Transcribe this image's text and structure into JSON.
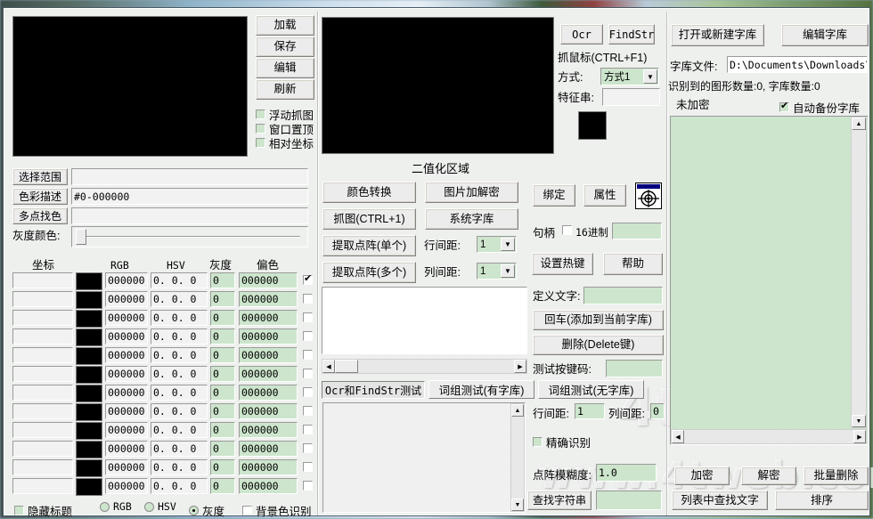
{
  "window": {
    "title": ""
  },
  "capture": {
    "buttons": [
      {
        "name": "load",
        "label": "加载"
      },
      {
        "name": "save",
        "label": "保存"
      },
      {
        "name": "edit",
        "label": "编辑"
      },
      {
        "name": "refresh",
        "label": "刷新"
      }
    ],
    "checkboxes": [
      {
        "name": "float-capture",
        "label": "浮动抓图",
        "checked": false
      },
      {
        "name": "window-topmost",
        "label": "窗口置顶",
        "checked": false
      },
      {
        "name": "relative-coords",
        "label": "相对坐标",
        "checked": false
      }
    ]
  },
  "color_tools": {
    "select_range_label": "选择范围",
    "select_range_value": "",
    "color_desc_label": "色彩描述",
    "color_desc_value": "#0-000000",
    "multipoint_label": "多点找色",
    "multipoint_value": "",
    "gray_color_label": "灰度颜色:",
    "gray_slider_value": 0
  },
  "color_table": {
    "headers": [
      "坐标",
      "RGB",
      "HSV",
      "灰度",
      "偏色"
    ],
    "rows": [
      {
        "coord": "",
        "swatch": "#000000",
        "rgb": "000000",
        "hsv": "0. 0. 0",
        "gray": "0",
        "offset": "000000",
        "checked": true
      },
      {
        "coord": "",
        "swatch": "#000000",
        "rgb": "000000",
        "hsv": "0. 0. 0",
        "gray": "0",
        "offset": "000000",
        "checked": false
      },
      {
        "coord": "",
        "swatch": "#000000",
        "rgb": "000000",
        "hsv": "0. 0. 0",
        "gray": "0",
        "offset": "000000",
        "checked": false
      },
      {
        "coord": "",
        "swatch": "#000000",
        "rgb": "000000",
        "hsv": "0. 0. 0",
        "gray": "0",
        "offset": "000000",
        "checked": false
      },
      {
        "coord": "",
        "swatch": "#000000",
        "rgb": "000000",
        "hsv": "0. 0. 0",
        "gray": "0",
        "offset": "000000",
        "checked": false
      },
      {
        "coord": "",
        "swatch": "#000000",
        "rgb": "000000",
        "hsv": "0. 0. 0",
        "gray": "0",
        "offset": "000000",
        "checked": false
      },
      {
        "coord": "",
        "swatch": "#000000",
        "rgb": "000000",
        "hsv": "0. 0. 0",
        "gray": "0",
        "offset": "000000",
        "checked": false
      },
      {
        "coord": "",
        "swatch": "#000000",
        "rgb": "000000",
        "hsv": "0. 0. 0",
        "gray": "0",
        "offset": "000000",
        "checked": false
      },
      {
        "coord": "",
        "swatch": "#000000",
        "rgb": "000000",
        "hsv": "0. 0. 0",
        "gray": "0",
        "offset": "000000",
        "checked": false
      },
      {
        "coord": "",
        "swatch": "#000000",
        "rgb": "000000",
        "hsv": "0. 0. 0",
        "gray": "0",
        "offset": "000000",
        "checked": false
      },
      {
        "coord": "",
        "swatch": "#000000",
        "rgb": "000000",
        "hsv": "0. 0. 0",
        "gray": "0",
        "offset": "000000",
        "checked": false
      },
      {
        "coord": "",
        "swatch": "#000000",
        "rgb": "000000",
        "hsv": "0. 0. 0",
        "gray": "0",
        "offset": "000000",
        "checked": false
      }
    ]
  },
  "footer_left": {
    "hide_title": {
      "label": "隐藏标题",
      "checked": false
    },
    "modes": [
      {
        "name": "rgb",
        "label": "RGB",
        "selected": false
      },
      {
        "name": "hsv",
        "label": "HSV",
        "selected": false
      },
      {
        "name": "gray",
        "label": "灰度",
        "selected": true
      }
    ],
    "bg_recognize": {
      "label": "背景色识别",
      "checked": false
    }
  },
  "binarize": {
    "caption": "二值化区域",
    "buttons": [
      {
        "name": "color-convert",
        "label": "颜色转换"
      },
      {
        "name": "image-encrypt",
        "label": "图片加解密"
      },
      {
        "name": "capture",
        "label": "抓图(CTRL+1)"
      },
      {
        "name": "system-font-lib",
        "label": "系统字库"
      },
      {
        "name": "extract-dots-single",
        "label": "提取点阵(单个)"
      },
      {
        "name": "extract-dots-multi",
        "label": "提取点阵(多个)"
      }
    ],
    "row_spacing_label": "行间距:",
    "row_spacing_value": "1",
    "col_spacing_label": "列间距:",
    "col_spacing_value": "1",
    "preview_text": ""
  },
  "tabs": [
    {
      "name": "ocr-findstr-test",
      "label": "Ocr和FindStr测试",
      "selected": true
    },
    {
      "name": "phrase-test-withlib",
      "label": "词组测试(有字库)",
      "selected": false
    },
    {
      "name": "phrase-test-nolib",
      "label": "词组测试(无字库)",
      "selected": false
    }
  ],
  "result_text": "",
  "ocr": {
    "ocr_button": "Ocr",
    "findstr_button": "FindStr",
    "mouse_capture_label": "抓鼠标(CTRL+F1)",
    "mode_label": "方式:",
    "mode_value": "方式1",
    "feature_label": "特征串:",
    "feature_value": "",
    "swatch": "#000000"
  },
  "window_tools": {
    "bind_button": "绑定",
    "property_button": "属性",
    "finder_icon": "crosshair-target-icon",
    "handle_label": "句柄",
    "hex_label": "16进制",
    "hex_checked": false,
    "handle_value": "",
    "set_hotkey_button": "设置热键",
    "help_button": "帮助"
  },
  "define": {
    "text_label": "定义文字:",
    "text_value": "",
    "enter_button": "回车(添加到当前字库)",
    "delete_button": "删除(Delete键)",
    "keycode_label": "测试按键码:",
    "keycode_value": ""
  },
  "recognize": {
    "row_spacing_label": "行间距:",
    "row_spacing_value": "1",
    "col_spacing_label": "列间距:",
    "col_spacing_value": "0",
    "exact_label": "精确识别",
    "exact_checked": false,
    "fuzzy_label": "点阵模糊度:",
    "fuzzy_value": "1.0",
    "find_string_button": "查找字符串",
    "find_string_value": ""
  },
  "fontlib": {
    "open_button": "打开或新建字库",
    "edit_button": "编辑字库",
    "file_label": "字库文件:",
    "file_value": "D:\\Documents\\Downloads\\dm\\",
    "counts_text": "识别到的图形数量:0, 字库数量:0",
    "encrypt_status": "未加密",
    "auto_backup_label": "自动备份字库",
    "auto_backup_checked": true,
    "list_items": [],
    "encrypt_button": "加密",
    "decrypt_button": "解密",
    "batch_delete_button": "批量删除",
    "find_in_list_button": "列表中查找文字",
    "sort_button": "排序"
  },
  "watermarks": [
    {
      "name": "watermark-logo",
      "text": "4t网"
    },
    {
      "name": "watermark-url",
      "text": "www.4tweb.com"
    }
  ],
  "colors": {
    "panel_bg": "#eef0ee",
    "field_green": "#cce5cc",
    "field_gray": "#f2f2f2",
    "black": "#000000"
  }
}
